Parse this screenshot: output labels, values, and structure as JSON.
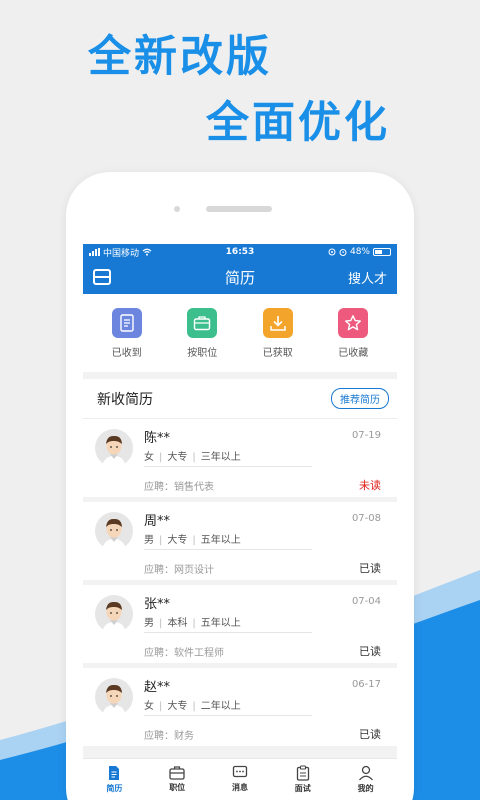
{
  "promo": {
    "line1": "全新改版",
    "line2": "全面优化"
  },
  "status_bar": {
    "carrier": "中国移动",
    "time": "16:53",
    "battery": "48%",
    "battery_level": 0.48
  },
  "nav": {
    "title": "简历",
    "right_action": "搜人才"
  },
  "quick_actions": [
    {
      "label": "已收到",
      "icon": "document-icon",
      "color": "#6c86e0"
    },
    {
      "label": "按职位",
      "icon": "briefcase-icon",
      "color": "#3cbf8c"
    },
    {
      "label": "已获取",
      "icon": "download-icon",
      "color": "#f3a42a"
    },
    {
      "label": "已收藏",
      "icon": "star-icon",
      "color": "#ee5a7d"
    }
  ],
  "section": {
    "title": "新收简历",
    "button": "推荐简历"
  },
  "apply_prefix": "应聘：",
  "resumes": [
    {
      "name": "陈**",
      "date": "07-19",
      "gender": "女",
      "education": "大专",
      "experience": "三年以上",
      "position": "销售代表",
      "status": "未读"
    },
    {
      "name": "周**",
      "date": "07-08",
      "gender": "男",
      "education": "大专",
      "experience": "五年以上",
      "position": "网页设计",
      "status": "已读"
    },
    {
      "name": "张**",
      "date": "07-04",
      "gender": "男",
      "education": "本科",
      "experience": "五年以上",
      "position": "软件工程师",
      "status": "已读"
    },
    {
      "name": "赵**",
      "date": "06-17",
      "gender": "女",
      "education": "大专",
      "experience": "二年以上",
      "position": "财务",
      "status": "已读"
    }
  ],
  "tabs": [
    {
      "label": "简历",
      "icon": "resume-icon",
      "active": true
    },
    {
      "label": "职位",
      "icon": "briefcase-icon",
      "active": false
    },
    {
      "label": "消息",
      "icon": "message-icon",
      "active": false
    },
    {
      "label": "面试",
      "icon": "clipboard-icon",
      "active": false
    },
    {
      "label": "我的",
      "icon": "user-icon",
      "active": false
    }
  ],
  "colors": {
    "brand": "#1779d3",
    "promo_text": "#1a8fe8",
    "unread": "#e0201b"
  }
}
